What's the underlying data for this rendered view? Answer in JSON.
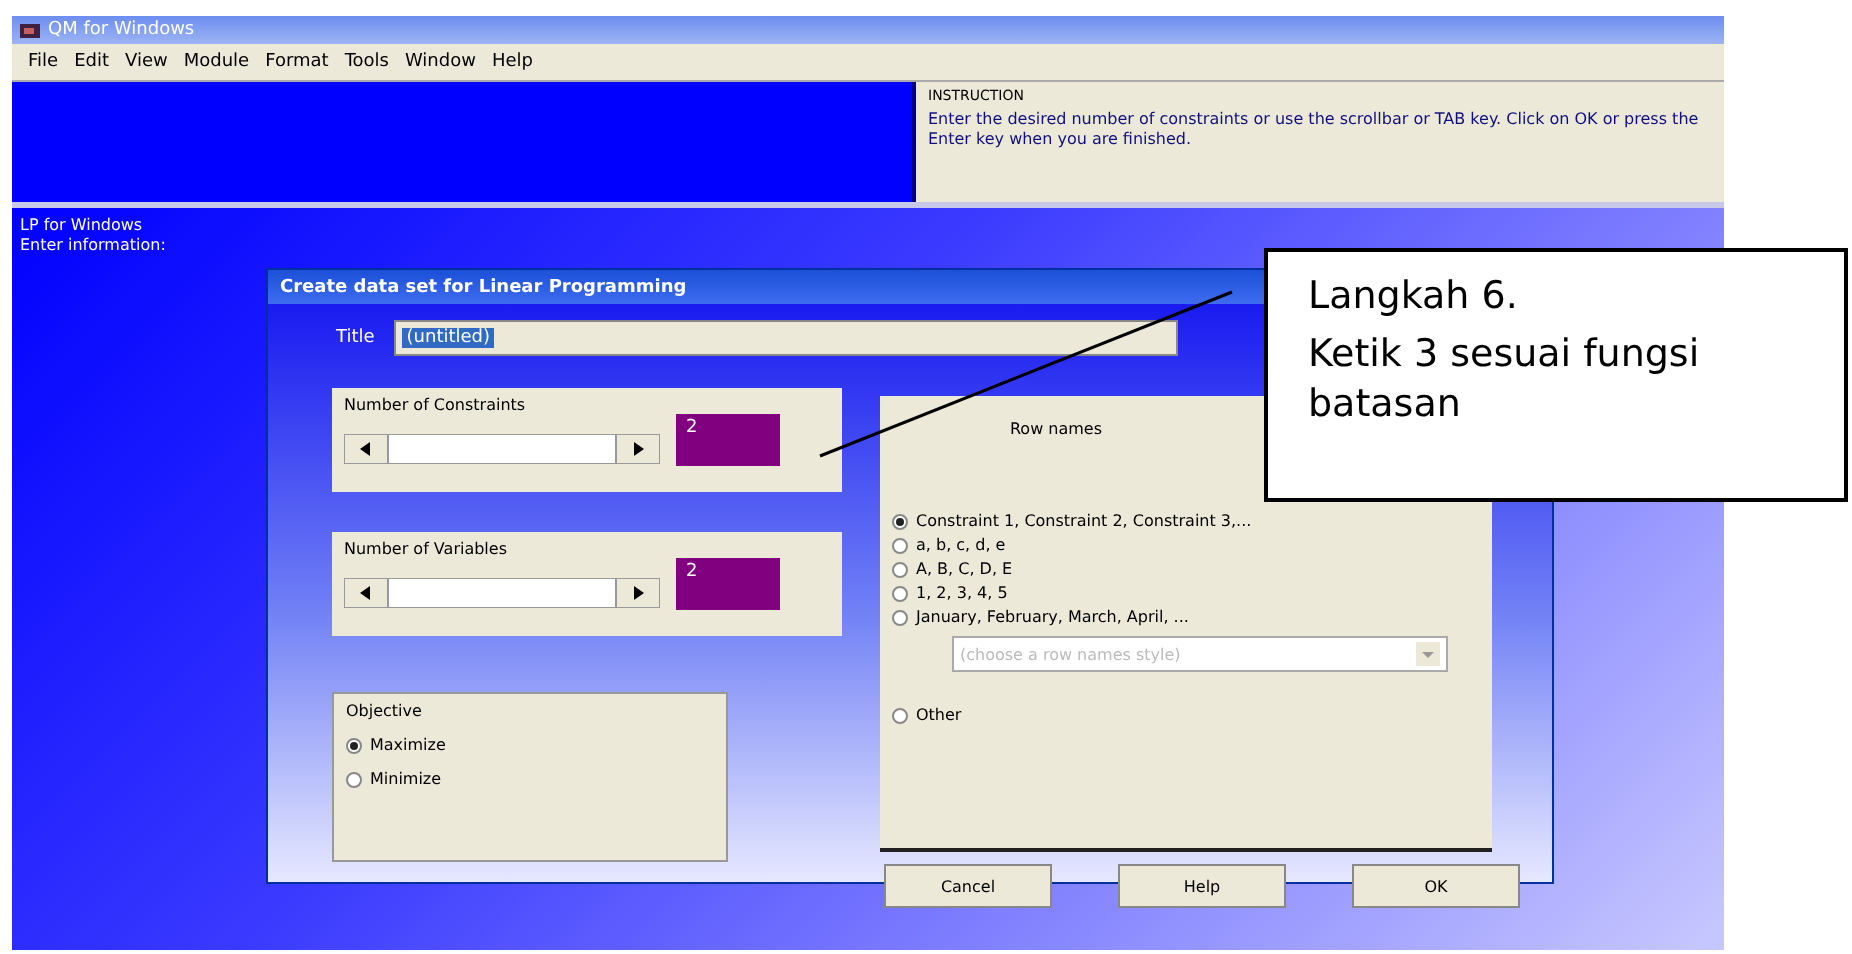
{
  "window": {
    "title": "QM for Windows"
  },
  "menu": [
    "File",
    "Edit",
    "View",
    "Module",
    "Format",
    "Tools",
    "Window",
    "Help"
  ],
  "instruction": {
    "title": "INSTRUCTION",
    "text": "Enter the desired number of constraints or use the scrollbar or TAB key. Click on OK or press the Enter key when you are finished."
  },
  "side_labels": [
    "LP for Windows",
    "Enter information:"
  ],
  "dialog": {
    "title": "Create data set for Linear Programming",
    "title_field": {
      "label": "Title",
      "value": "(untitled)"
    },
    "spinners": [
      {
        "label": "Number of Constraints",
        "value": "2"
      },
      {
        "label": "Number of Variables",
        "value": "2"
      }
    ],
    "objective": {
      "label": "Objective",
      "options": [
        {
          "label": "Maximize",
          "selected": true
        },
        {
          "label": "Minimize",
          "selected": false
        }
      ]
    },
    "tab": "Row names",
    "row_names": [
      {
        "label": "Constraint 1, Constraint 2, Constraint 3,...",
        "selected": true
      },
      {
        "label": "a, b, c, d, e",
        "selected": false
      },
      {
        "label": "A, B, C, D, E",
        "selected": false
      },
      {
        "label": "1, 2, 3, 4, 5",
        "selected": false
      },
      {
        "label": "January, February, March, April, ...",
        "selected": false
      },
      {
        "label": "Other",
        "selected": false
      }
    ],
    "row_names_dropdown": {
      "value": "(choose a row names style)",
      "disabled": true
    },
    "buttons": [
      "Cancel",
      "Help",
      "OK"
    ]
  },
  "callout": {
    "lines": [
      "Langkah 6.",
      "Ketik 3 sesuai fungsi batasan"
    ]
  }
}
